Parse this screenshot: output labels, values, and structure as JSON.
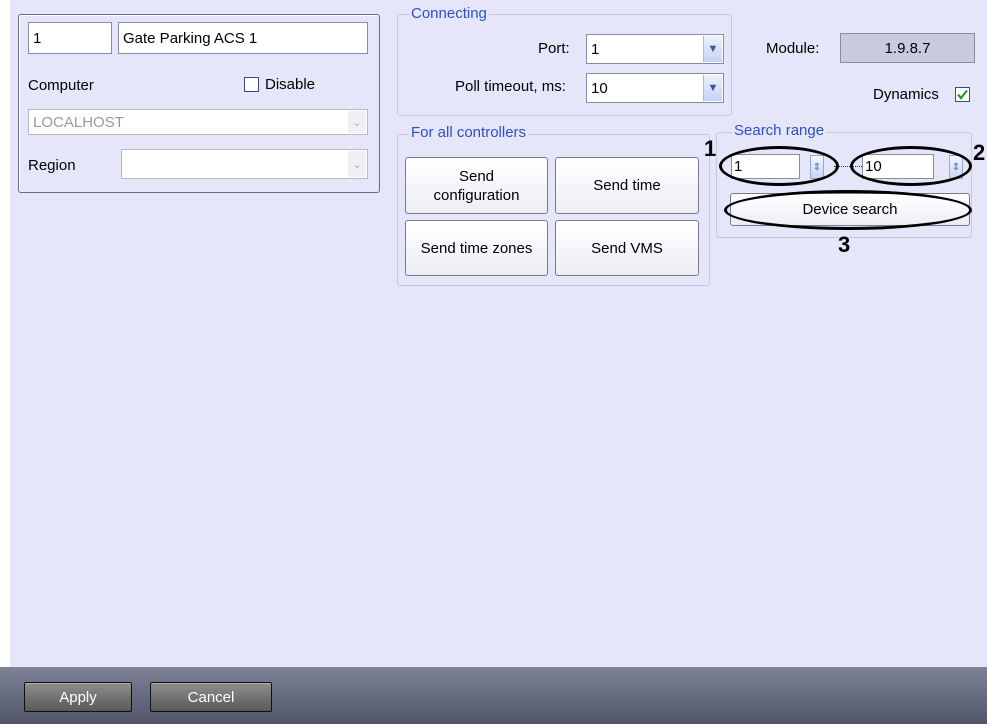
{
  "object": {
    "id": "1",
    "name": "Gate Parking ACS 1",
    "computer_label": "Computer",
    "disable_label": "Disable",
    "computer_value": "LOCALHOST",
    "region_label": "Region",
    "region_value": ""
  },
  "connecting": {
    "title": "Connecting",
    "port_label": "Port:",
    "port_value": "1",
    "poll_label": "Poll timeout, ms:",
    "poll_value": "10",
    "module_label": "Module:",
    "module_value": "1.9.8.7",
    "dynamics_label": "Dynamics",
    "dynamics_checked": true
  },
  "controllers": {
    "title": "For all controllers",
    "send_configuration": "Send configuration",
    "send_time": "Send time",
    "send_time_zones": "Send time zones",
    "send_vms": "Send VMS"
  },
  "search": {
    "title": "Search range",
    "from_value": "1",
    "to_value": "10",
    "device_search": "Device search"
  },
  "callouts": [
    "1",
    "2",
    "3"
  ],
  "footer": {
    "apply": "Apply",
    "cancel": "Cancel"
  }
}
